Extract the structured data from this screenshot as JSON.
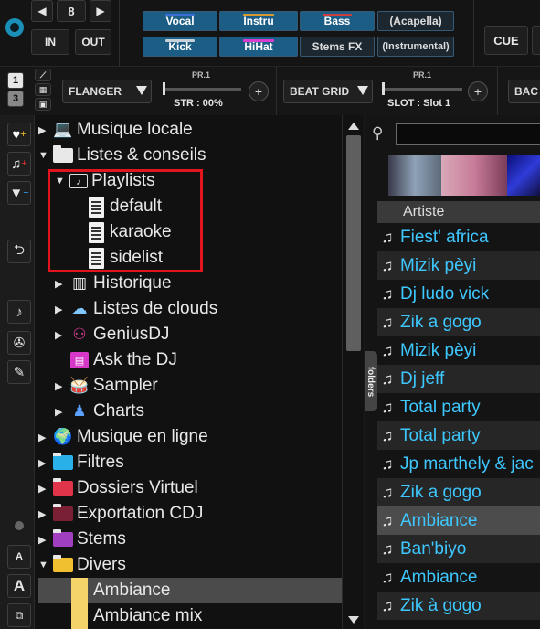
{
  "topbar": {
    "counter_value": "8",
    "in_label": "IN",
    "out_label": "OUT",
    "cue_label": "CUE",
    "pads": [
      {
        "label": "Vocal",
        "bar": "#3b6fd6"
      },
      {
        "label": "Instru",
        "bar": "#d89a2e"
      },
      {
        "label": "Bass",
        "bar": "#cf3d3d"
      },
      {
        "label": "(Acapella)",
        "bar": ""
      },
      {
        "label": "Kick",
        "bar": "#c8d0d8"
      },
      {
        "label": "HiHat",
        "bar": "#d83dd0"
      },
      {
        "label": "Stems FX",
        "bar": ""
      },
      {
        "label": "(Instrumental)",
        "bar": ""
      }
    ]
  },
  "effects": {
    "deck_numbers": [
      "1",
      "3"
    ],
    "fx1": {
      "name": "FLANGER",
      "param_title": "PR.1",
      "param_value": "STR :  00%"
    },
    "fx2": {
      "name": "BEAT GRID",
      "param_title": "PR.1",
      "param_value": "SLOT :  Slot 1"
    },
    "fx3": {
      "name": "BAC"
    },
    "plus_label": "+"
  },
  "sidebar_tools": [
    "heart-plus-icon",
    "karaoke-plus-icon",
    "filter-plus-icon",
    "back-arrow-icon",
    "music-note-icon",
    "film-reel-icon",
    "eyedropper-icon",
    "dot-icon",
    "font-small-icon",
    "font-large-icon",
    "window-icon"
  ],
  "tree": {
    "items": [
      {
        "label": "Musique locale",
        "icon": "computer-icon"
      },
      {
        "label": "Listes & conseils",
        "icon": "folder-icon"
      },
      {
        "label": "Playlists",
        "icon": "playlist-folder-icon"
      },
      {
        "label": "default",
        "icon": "playlist-document-icon"
      },
      {
        "label": "karaoke",
        "icon": "playlist-document-icon"
      },
      {
        "label": "sidelist",
        "icon": "playlist-document-icon"
      },
      {
        "label": "Historique",
        "icon": "history-icon"
      },
      {
        "label": "Listes de clouds",
        "icon": "cloud-icon"
      },
      {
        "label": "GeniusDJ",
        "icon": "genius-icon"
      },
      {
        "label": "Ask the DJ",
        "icon": "chat-icon"
      },
      {
        "label": "Sampler",
        "icon": "drum-icon"
      },
      {
        "label": "Charts",
        "icon": "trophy-icon"
      },
      {
        "label": "Musique en ligne",
        "icon": "globe-icon"
      },
      {
        "label": "Filtres",
        "icon": "filter-folder-icon"
      },
      {
        "label": "Dossiers Virtuel",
        "icon": "virtual-folder-icon"
      },
      {
        "label": "Exportation CDJ",
        "icon": "cdj-icon"
      },
      {
        "label": "Stems",
        "icon": "stems-icon"
      },
      {
        "label": "Divers",
        "icon": "favorite-folder-icon"
      },
      {
        "label": "Ambiance",
        "icon": "yellow-folder-icon"
      },
      {
        "label": "Ambiance mix",
        "icon": "yellow-folder-icon"
      }
    ],
    "side_tab": "folders"
  },
  "tracklist": {
    "column_header": "Artiste",
    "rows": [
      "Fiest' africa",
      "Mizik pèyi",
      "Dj ludo vick",
      "Zik a gogo",
      "Mizik pèyi",
      "Dj jeff",
      "Total party",
      "Total party",
      "Jp marthely & jac",
      "Zik a gogo",
      "Ambiance",
      "Ban'biyo",
      "Ambiance",
      "Zik à gogo"
    ]
  },
  "colors": {
    "accent_blue": "#3ec8ff",
    "highlight_red": "#e2151e",
    "pad_blue": "#1c5d86"
  }
}
